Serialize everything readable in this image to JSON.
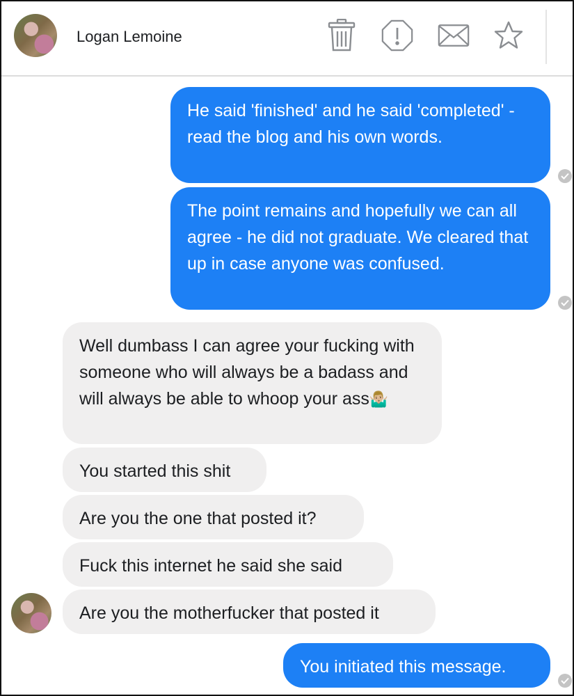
{
  "header": {
    "contact_name": "Logan Lemoine",
    "icons": [
      "trash-icon",
      "report-icon",
      "mail-icon",
      "star-icon"
    ]
  },
  "messages": [
    {
      "direction": "outgoing",
      "text": "He said 'finished' and he said 'completed' - read the blog and his own words."
    },
    {
      "direction": "outgoing",
      "text": "The point remains and hopefully we can all agree - he did not graduate.  We cleared that up in case anyone was confused."
    },
    {
      "direction": "incoming",
      "text": "Well dumbass I can agree your fucking with someone who will always be a badass and will always be able to whoop your ass",
      "emoji": "🤷🏼‍♂️"
    },
    {
      "direction": "incoming",
      "text": "You started this shit"
    },
    {
      "direction": "incoming",
      "text": "Are you the one that posted it?"
    },
    {
      "direction": "incoming",
      "text": "Fuck this internet he said she said"
    },
    {
      "direction": "incoming",
      "text": "Are you the motherfucker that posted it"
    },
    {
      "direction": "outgoing",
      "text": "You initiated this message."
    }
  ],
  "colors": {
    "outgoing_bubble": "#1d80f5",
    "incoming_bubble": "#f0efef",
    "icon_gray": "#8a8d91"
  }
}
